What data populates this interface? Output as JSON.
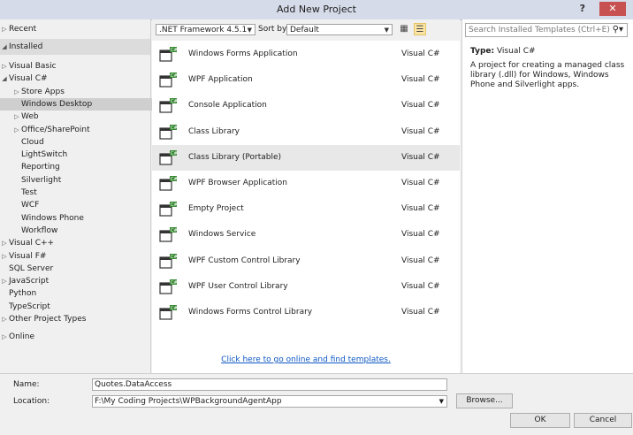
{
  "window": {
    "title": "Add New Project",
    "help": "?",
    "close": "✕"
  },
  "left": {
    "recent": "Recent",
    "installed": "Installed",
    "online": "Online",
    "tree": [
      {
        "label": "Visual Basic",
        "indent": 0,
        "tri": "▷"
      },
      {
        "label": "Visual C#",
        "indent": 0,
        "tri": "◢"
      },
      {
        "label": "Store Apps",
        "indent": 1,
        "tri": "▷"
      },
      {
        "label": "Windows Desktop",
        "indent": 1,
        "tri": "",
        "selected": true
      },
      {
        "label": "Web",
        "indent": 1,
        "tri": "▷"
      },
      {
        "label": "Office/SharePoint",
        "indent": 1,
        "tri": "▷"
      },
      {
        "label": "Cloud",
        "indent": 1,
        "tri": ""
      },
      {
        "label": "LightSwitch",
        "indent": 1,
        "tri": ""
      },
      {
        "label": "Reporting",
        "indent": 1,
        "tri": ""
      },
      {
        "label": "Silverlight",
        "indent": 1,
        "tri": ""
      },
      {
        "label": "Test",
        "indent": 1,
        "tri": ""
      },
      {
        "label": "WCF",
        "indent": 1,
        "tri": ""
      },
      {
        "label": "Windows Phone",
        "indent": 1,
        "tri": ""
      },
      {
        "label": "Workflow",
        "indent": 1,
        "tri": ""
      },
      {
        "label": "Visual C++",
        "indent": 0,
        "tri": "▷"
      },
      {
        "label": "Visual F#",
        "indent": 0,
        "tri": "▷"
      },
      {
        "label": "SQL Server",
        "indent": 0,
        "tri": ""
      },
      {
        "label": "JavaScript",
        "indent": 0,
        "tri": "▷"
      },
      {
        "label": "Python",
        "indent": 0,
        "tri": ""
      },
      {
        "label": "TypeScript",
        "indent": 0,
        "tri": ""
      },
      {
        "label": "Other Project Types",
        "indent": 0,
        "tri": "▷"
      }
    ]
  },
  "toolbar": {
    "framework": ".NET Framework 4.5.1",
    "sort_label": "Sort by:",
    "sort_value": "Default"
  },
  "templates": [
    {
      "name": "Windows Forms Application",
      "lang": "Visual C#",
      "icon": "windows-forms-app-icon"
    },
    {
      "name": "WPF Application",
      "lang": "Visual C#",
      "icon": "wpf-app-icon"
    },
    {
      "name": "Console Application",
      "lang": "Visual C#",
      "icon": "console-app-icon"
    },
    {
      "name": "Class Library",
      "lang": "Visual C#",
      "icon": "class-library-icon"
    },
    {
      "name": "Class Library (Portable)",
      "lang": "Visual C#",
      "icon": "portable-class-library-icon",
      "selected": true
    },
    {
      "name": "WPF Browser Application",
      "lang": "Visual C#",
      "icon": "wpf-browser-app-icon"
    },
    {
      "name": "Empty Project",
      "lang": "Visual C#",
      "icon": "empty-project-icon"
    },
    {
      "name": "Windows Service",
      "lang": "Visual C#",
      "icon": "windows-service-icon"
    },
    {
      "name": "WPF Custom Control Library",
      "lang": "Visual C#",
      "icon": "wpf-custom-control-icon"
    },
    {
      "name": "WPF User Control Library",
      "lang": "Visual C#",
      "icon": "wpf-user-control-icon"
    },
    {
      "name": "Windows Forms Control Library",
      "lang": "Visual C#",
      "icon": "winforms-control-library-icon"
    }
  ],
  "online_link": "Click here to go online and find templates.",
  "details": {
    "search_placeholder": "Search Installed Templates (Ctrl+E)",
    "type_label": "Type:",
    "type_value": "Visual C#",
    "description": "A project for creating a managed class library (.dll) for Windows, Windows Phone and Silverlight apps."
  },
  "form": {
    "name_label": "Name:",
    "name_value": "Quotes.DataAccess",
    "location_label": "Location:",
    "location_value": "F:\\My Coding Projects\\WPBackgroundAgentApp",
    "browse": "Browse...",
    "ok": "OK",
    "cancel": "Cancel"
  },
  "colors": {
    "accent": "#0e58c3",
    "close": "#c75050",
    "titlebar": "#d6dbe9"
  }
}
